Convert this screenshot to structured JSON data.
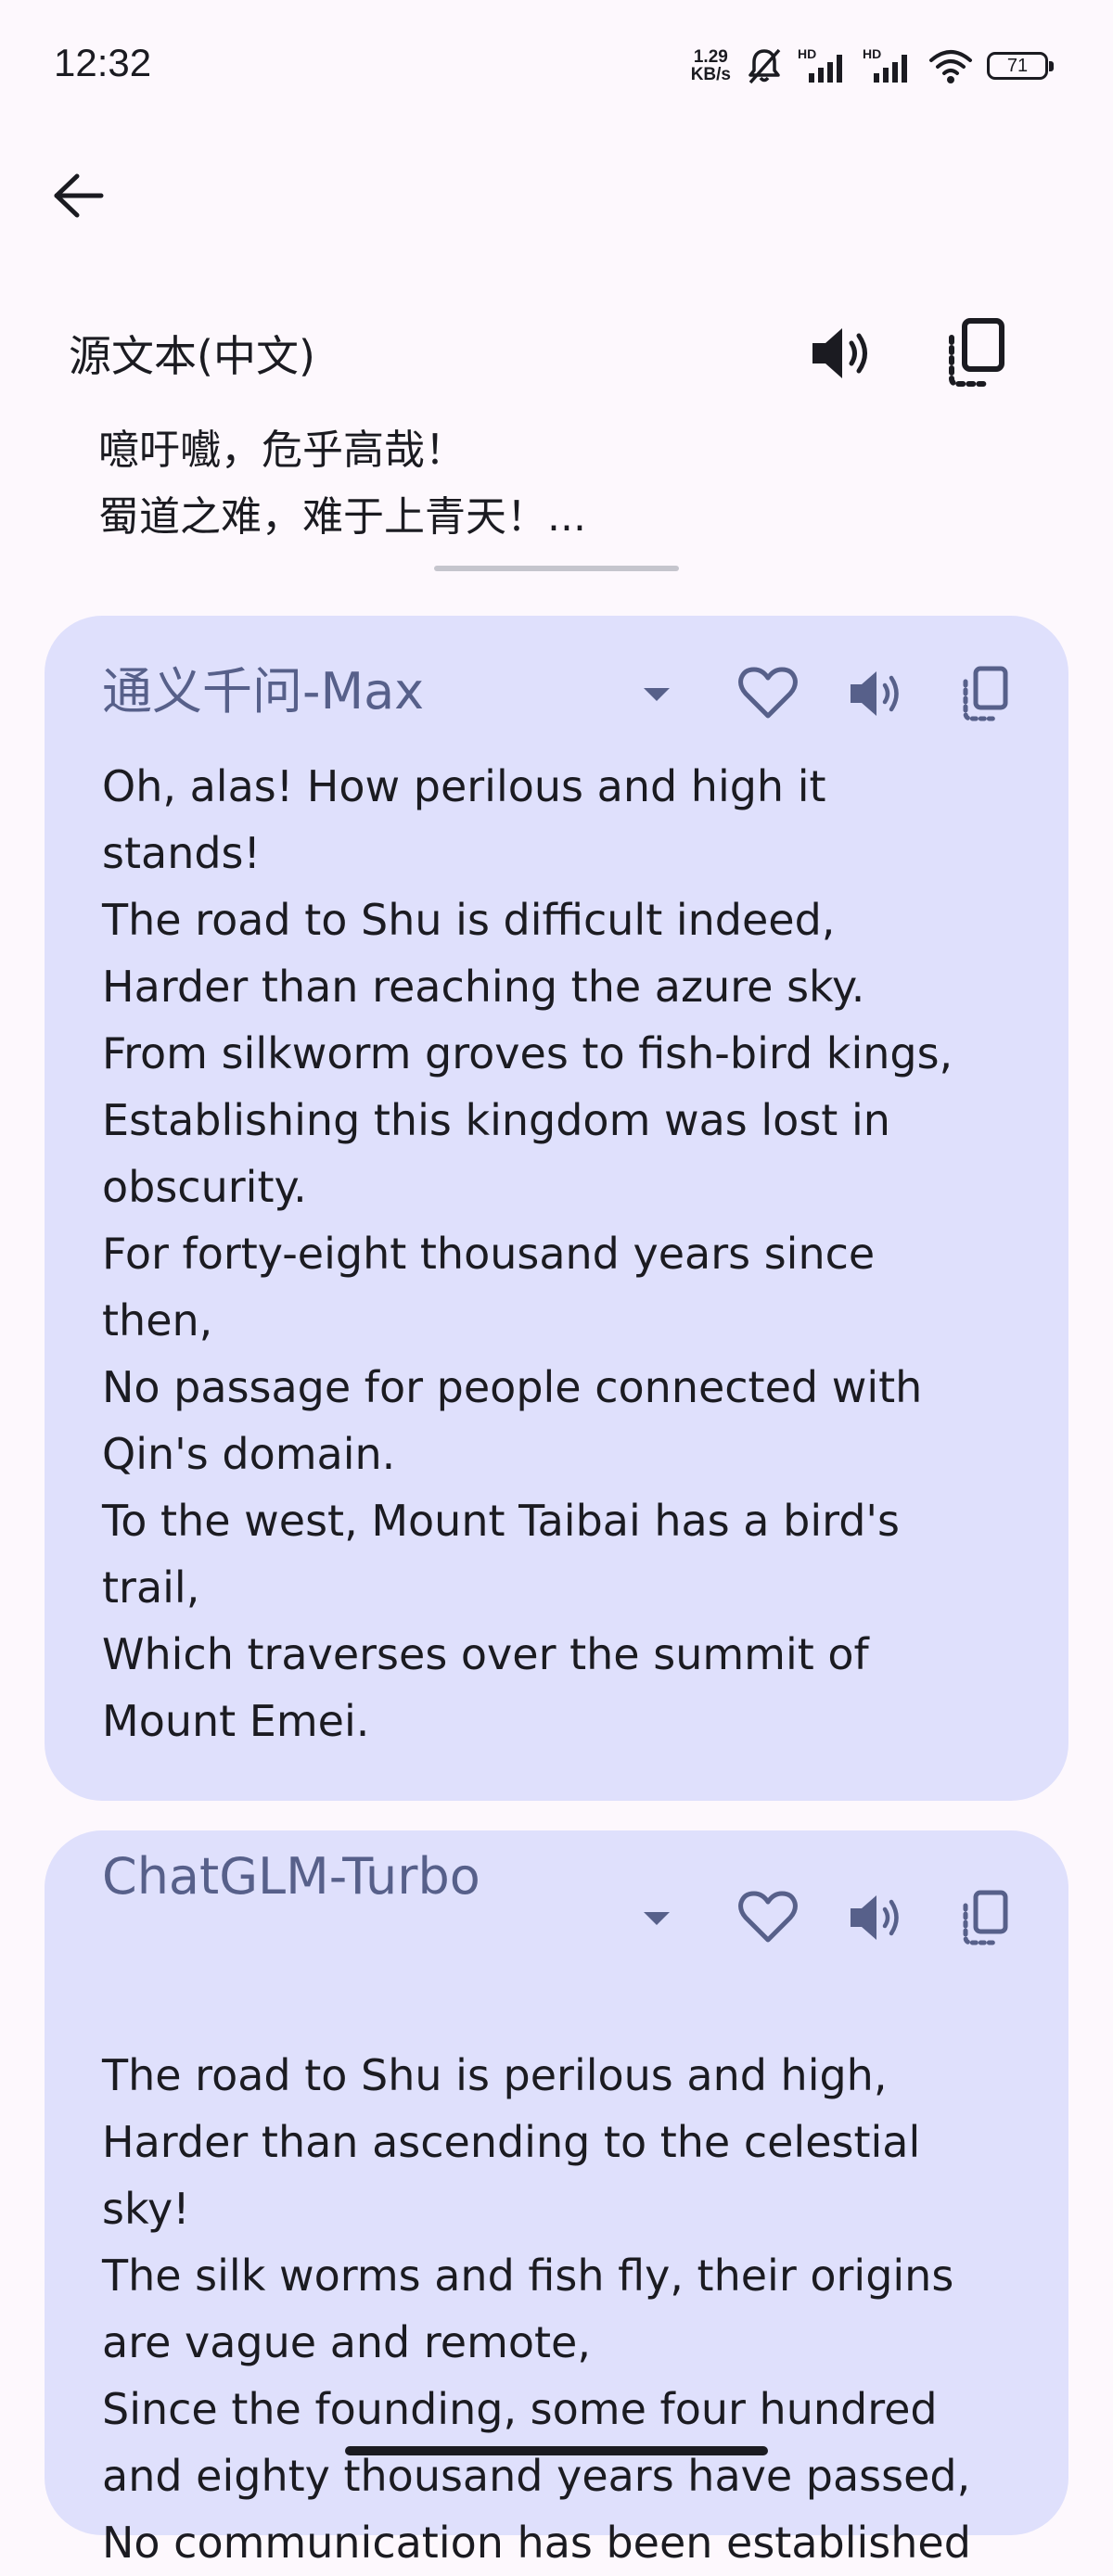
{
  "status_bar": {
    "time": "12:32",
    "net_speed_value": "1.29",
    "net_speed_unit": "KB/s",
    "signal_1_label": "HD",
    "signal_2_label": "HD",
    "battery_level": "71"
  },
  "source": {
    "label": "源文本(中文)",
    "lines": [
      "噫吁嚱，危乎高哉！",
      "蜀道之难，难于上青天！..."
    ]
  },
  "translations": [
    {
      "model": "通义千问-Max",
      "lines": [
        "Oh, alas! How perilous and high it",
        "stands!",
        "The road to Shu is difficult indeed,",
        "Harder than reaching the azure sky.",
        "From silkworm groves to fish-bird kings,",
        "Establishing this kingdom was lost in",
        "obscurity.",
        "For forty-eight thousand years since",
        "then,",
        "No passage for people connected with",
        "Qin's domain.",
        "To the west, Mount Taibai has a bird's",
        "trail,",
        "Which traverses over the summit of",
        "Mount Emei."
      ]
    },
    {
      "model": "ChatGLM-Turbo",
      "lines": [
        "The road to Shu is perilous and high,",
        "Harder than ascending to the celestial",
        "sky!",
        "The silk worms and fish fly, their origins",
        "are vague and remote,",
        "Since the founding, some four hundred",
        "and eighty thousand years have passed,",
        "No communication has been established"
      ]
    }
  ],
  "colors": {
    "background": "#fdf8fd",
    "card": "#dfe0fc",
    "accent": "#57608a",
    "text": "#1b1b21"
  },
  "icons": [
    "back-arrow-icon",
    "speaker-icon",
    "copy-icon",
    "dropdown-arrow-icon",
    "heart-icon"
  ]
}
